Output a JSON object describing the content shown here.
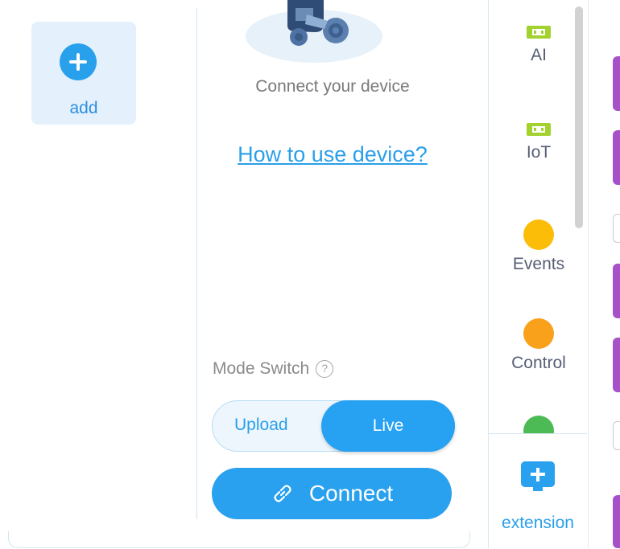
{
  "device_panel": {
    "add_label": "add",
    "connect_text": "Connect your device",
    "howto_link": "How to use device?",
    "mode_switch_label": "Mode Switch",
    "help_symbol": "?",
    "mode_options": [
      "Upload",
      "Live"
    ],
    "selected_mode": "Live",
    "connect_button_label": "Connect"
  },
  "categories": [
    {
      "label": "AI",
      "icon": "ai-module-icon",
      "color": "#a3d12d"
    },
    {
      "label": "IoT",
      "icon": "iot-module-icon",
      "color": "#a3d12d"
    },
    {
      "label": "Events",
      "icon": "events-dot-icon",
      "color": "#fbbd08"
    },
    {
      "label": "Control",
      "icon": "control-dot-icon",
      "color": "#f9a11b"
    },
    {
      "label": "",
      "icon": "operators-dot-icon",
      "color": "#4cbb55"
    }
  ],
  "extension": {
    "label": "extension",
    "icon": "add-extension-icon"
  },
  "colors": {
    "accent": "#29a1ee",
    "link": "#2a9fea",
    "block_purple": "#a651c9"
  }
}
